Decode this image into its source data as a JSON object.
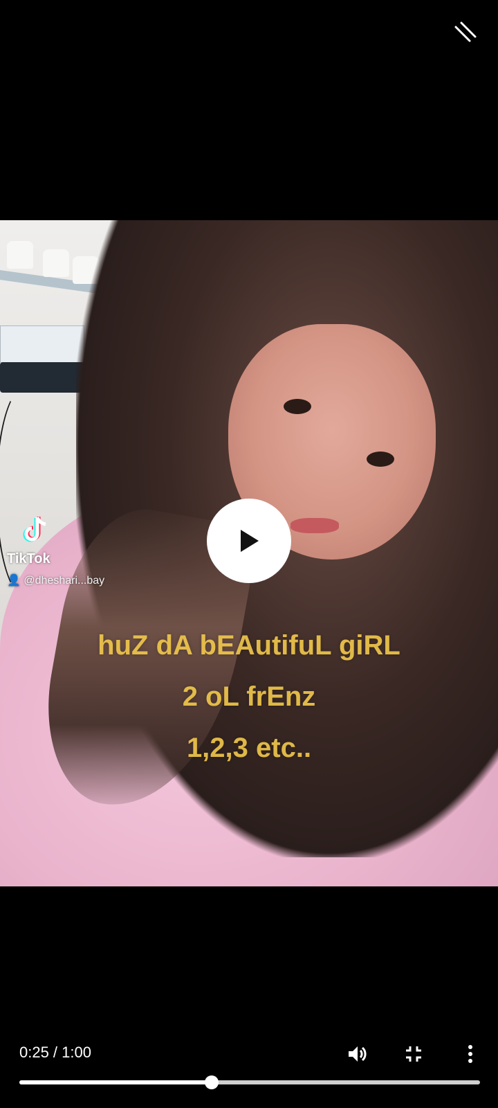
{
  "player": {
    "collapse_icon": "collapse-icon",
    "play_icon": "play-icon",
    "time_display": "0:25 / 1:00",
    "progress_fraction": 0.4167,
    "volume_icon": "volume-icon",
    "exit_fullscreen_icon": "exit-fullscreen-icon",
    "more_icon": "more-options-icon"
  },
  "video": {
    "watermark_name": "TikTok",
    "watermark_user": "@dheshari...bay",
    "caption_lines": [
      "huZ dA bEAutifuL giRL",
      "2 oL frEnz",
      "1,2,3 etc.."
    ]
  }
}
